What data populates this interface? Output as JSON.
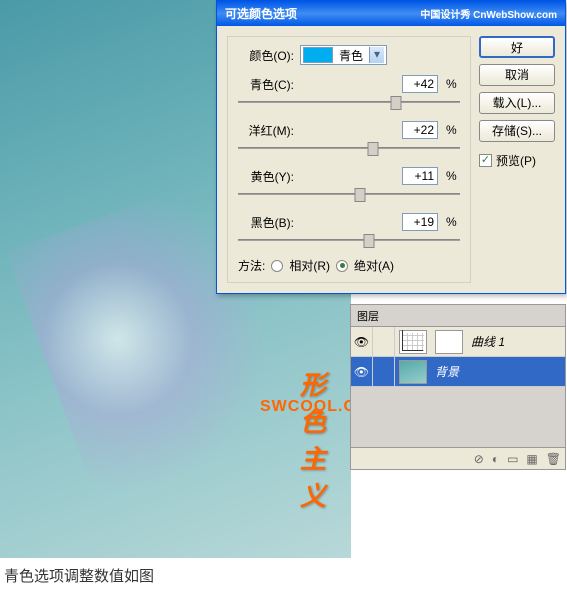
{
  "dialog": {
    "title": "可选颜色选项",
    "source": "中国设计秀 CnWebShow.com",
    "color_label": "颜色(O):",
    "color_value": "青色",
    "sliders": [
      {
        "label": "青色(C):",
        "value": "+42",
        "pos": 71
      },
      {
        "label": "洋红(M):",
        "value": "+22",
        "pos": 61
      },
      {
        "label": "黄色(Y):",
        "value": "+11",
        "pos": 55
      },
      {
        "label": "黑色(B):",
        "value": "+19",
        "pos": 59
      }
    ],
    "percent": "%",
    "method_label": "方法:",
    "method_relative": "相对(R)",
    "method_absolute": "绝对(A)"
  },
  "buttons": {
    "ok": "好",
    "cancel": "取消",
    "load": "载入(L)...",
    "save": "存储(S)...",
    "preview": "预览(P)"
  },
  "layers": {
    "tab": "图层",
    "curves": "曲线 1",
    "background": "背景"
  },
  "watermark": {
    "line1": "形色主义",
    "line2": "SWCOOL.COM"
  },
  "caption": "青色选项调整数值如图"
}
